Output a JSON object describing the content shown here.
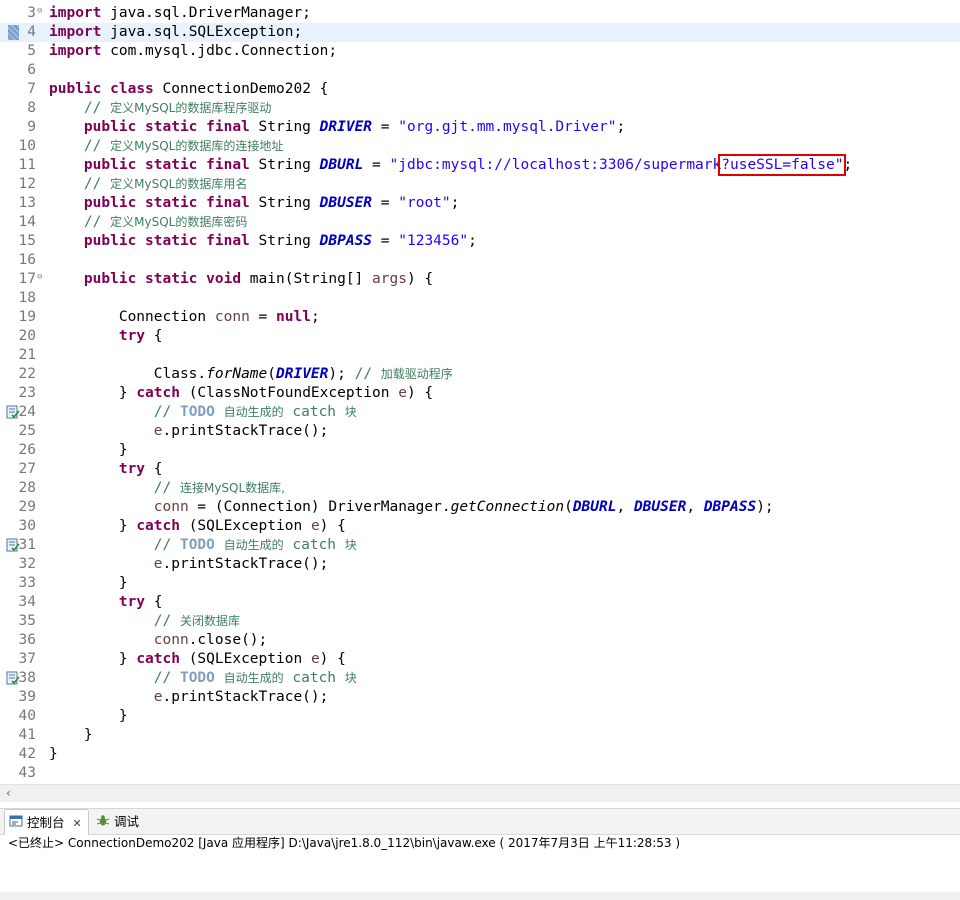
{
  "editor": {
    "lines": [
      {
        "n": "3",
        "fold": "⊖",
        "tokens": [
          [
            "kw",
            "import"
          ],
          [
            "",
            "java.sql.DriverManager;"
          ]
        ]
      },
      {
        "n": "4",
        "tokens": [
          [
            "kw",
            "import"
          ],
          [
            "",
            "java.sql.SQLException;"
          ]
        ]
      },
      {
        "n": "5",
        "tokens": [
          [
            "kw",
            "import"
          ],
          [
            "",
            "com.mysql.jdbc.Connection;"
          ]
        ]
      },
      {
        "n": "6",
        "tokens": []
      },
      {
        "n": "7",
        "tokens": [
          [
            "kw",
            "public"
          ],
          [
            "kw",
            "class"
          ],
          [
            "",
            "ConnectionDemo202 {"
          ]
        ]
      },
      {
        "n": "8",
        "tokens": [
          [
            "cm",
            "// "
          ],
          [
            "cm cjk",
            "定义MySQL的数据库程序驱动"
          ]
        ]
      },
      {
        "n": "9",
        "tokens": [
          [
            "kw",
            "public static final"
          ],
          [
            "",
            "String"
          ],
          [
            "cst",
            "DRIVER"
          ],
          [
            "",
            "="
          ],
          [
            "str",
            "\"org.gjt.mm.mysql.Driver\""
          ],
          [
            "",
            ";"
          ]
        ]
      },
      {
        "n": "10",
        "tokens": [
          [
            "cm",
            "// "
          ],
          [
            "cm cjk",
            "定义MySQL的数据库的连接地址"
          ]
        ]
      },
      {
        "n": "11",
        "tokens": [
          [
            "kw",
            "public static final"
          ],
          [
            "",
            "String"
          ],
          [
            "cst",
            "DBURL"
          ],
          [
            "",
            "="
          ],
          [
            "str",
            "\"jdbc:mysql://localhost:3306/supermark"
          ],
          [
            "str box",
            "?useSSL=false\""
          ],
          [
            "",
            ";"
          ]
        ]
      },
      {
        "n": "12",
        "tokens": [
          [
            "cm",
            "// "
          ],
          [
            "cm cjk",
            "定义MySQL的数据库用名"
          ]
        ]
      },
      {
        "n": "13",
        "tokens": [
          [
            "kw",
            "public static final"
          ],
          [
            "",
            "String"
          ],
          [
            "cst",
            "DBUSER"
          ],
          [
            "",
            "="
          ],
          [
            "str",
            "\"root\""
          ],
          [
            "",
            ";"
          ]
        ]
      },
      {
        "n": "14",
        "tokens": [
          [
            "cm",
            "// "
          ],
          [
            "cm cjk",
            "定义MySQL的数据库密码"
          ]
        ]
      },
      {
        "n": "15",
        "tokens": [
          [
            "kw",
            "public static final"
          ],
          [
            "",
            "String"
          ],
          [
            "cst",
            "DBPASS"
          ],
          [
            "",
            "="
          ],
          [
            "str",
            "\"123456\""
          ],
          [
            "",
            ";"
          ]
        ]
      },
      {
        "n": "16",
        "tokens": []
      },
      {
        "n": "17",
        "fold": "⊖",
        "tokens": [
          [
            "kw",
            "public static void"
          ],
          [
            "",
            "main(String[]"
          ],
          [
            "var",
            "args"
          ],
          [
            "",
            ") {"
          ]
        ]
      },
      {
        "n": "18",
        "tokens": []
      },
      {
        "n": "19",
        "tokens": [
          [
            "",
            "Connection"
          ],
          [
            "var",
            "conn"
          ],
          [
            "",
            "="
          ],
          [
            "kw",
            "null"
          ],
          [
            "",
            ";"
          ]
        ]
      },
      {
        "n": "20",
        "tokens": [
          [
            "kw",
            "try"
          ],
          [
            "",
            "{"
          ]
        ]
      },
      {
        "n": "21",
        "tokens": []
      },
      {
        "n": "22",
        "tokens": [
          [
            "",
            "Class."
          ],
          [
            "it",
            "forName"
          ],
          [
            "",
            "("
          ],
          [
            "cst",
            "DRIVER"
          ],
          [
            "",
            ");"
          ],
          [
            "cm",
            "// "
          ],
          [
            "cm cjk",
            "加载驱动程序"
          ]
        ]
      },
      {
        "n": "23",
        "tokens": [
          [
            "",
            "}"
          ],
          [
            "kw",
            "catch"
          ],
          [
            "",
            "(ClassNotFoundException"
          ],
          [
            "var",
            "e"
          ],
          [
            "",
            ") {"
          ]
        ]
      },
      {
        "n": "24",
        "mark": "task",
        "tokens": [
          [
            "cm",
            "//"
          ],
          [
            "todo",
            "TODO"
          ],
          [
            "cm cjk",
            "自动生成的"
          ],
          [
            "cm",
            "catch"
          ],
          [
            "cm cjk",
            "块"
          ]
        ]
      },
      {
        "n": "25",
        "tokens": [
          [
            "var",
            "e"
          ],
          [
            "",
            ".printStackTrace();"
          ]
        ]
      },
      {
        "n": "26",
        "tokens": [
          [
            "",
            "}"
          ]
        ]
      },
      {
        "n": "27",
        "tokens": [
          [
            "kw",
            "try"
          ],
          [
            "",
            "{"
          ]
        ]
      },
      {
        "n": "28",
        "tokens": [
          [
            "cm",
            "// "
          ],
          [
            "cm cjk",
            "连接MySQL数据库,"
          ]
        ]
      },
      {
        "n": "29",
        "tokens": [
          [
            "var",
            "conn"
          ],
          [
            "",
            "= (Connection) DriverManager."
          ],
          [
            "it",
            "getConnection"
          ],
          [
            "",
            "("
          ],
          [
            "cst",
            "DBURL"
          ],
          [
            "",
            ","
          ],
          [
            "cst",
            "DBUSER"
          ],
          [
            "",
            ","
          ],
          [
            "cst",
            "DBPASS"
          ],
          [
            "",
            ");"
          ]
        ]
      },
      {
        "n": "30",
        "tokens": [
          [
            "",
            "}"
          ],
          [
            "kw",
            "catch"
          ],
          [
            "",
            "(SQLException"
          ],
          [
            "var",
            "e"
          ],
          [
            "",
            ") {"
          ]
        ]
      },
      {
        "n": "31",
        "mark": "task",
        "tokens": [
          [
            "cm",
            "//"
          ],
          [
            "todo",
            "TODO"
          ],
          [
            "cm cjk",
            "自动生成的"
          ],
          [
            "cm",
            "catch"
          ],
          [
            "cm cjk",
            "块"
          ]
        ]
      },
      {
        "n": "32",
        "tokens": [
          [
            "var",
            "e"
          ],
          [
            "",
            ".printStackTrace();"
          ]
        ]
      },
      {
        "n": "33",
        "tokens": [
          [
            "",
            "}"
          ]
        ]
      },
      {
        "n": "34",
        "tokens": [
          [
            "kw",
            "try"
          ],
          [
            "",
            "{"
          ]
        ]
      },
      {
        "n": "35",
        "tokens": [
          [
            "cm",
            "// "
          ],
          [
            "cm cjk",
            "关闭数据库"
          ]
        ]
      },
      {
        "n": "36",
        "tokens": [
          [
            "var",
            "conn"
          ],
          [
            "",
            ".close();"
          ]
        ]
      },
      {
        "n": "37",
        "tokens": [
          [
            "",
            "}"
          ],
          [
            "kw",
            "catch"
          ],
          [
            "",
            "(SQLException"
          ],
          [
            "var",
            "e"
          ],
          [
            "",
            ") {"
          ]
        ]
      },
      {
        "n": "38",
        "mark": "task",
        "tokens": [
          [
            "cm",
            "//"
          ],
          [
            "todo",
            "TODO"
          ],
          [
            "cm cjk",
            "自动生成的"
          ],
          [
            "cm",
            "catch"
          ],
          [
            "cm cjk",
            "块"
          ]
        ]
      },
      {
        "n": "39",
        "tokens": [
          [
            "var",
            "e"
          ],
          [
            "",
            ".printStackTrace();"
          ]
        ]
      },
      {
        "n": "40",
        "tokens": [
          [
            "",
            "}"
          ]
        ]
      },
      {
        "n": "41",
        "tokens": [
          [
            "",
            "}"
          ]
        ]
      },
      {
        "n": "42",
        "tokens": [
          [
            "",
            "}"
          ]
        ]
      },
      {
        "n": "43",
        "tokens": []
      }
    ]
  },
  "console": {
    "tabs": [
      {
        "label": "控制台",
        "active": true,
        "icon": "console-icon"
      },
      {
        "label": "调试",
        "active": false,
        "icon": "debug-icon"
      }
    ],
    "status": "<已终止> ConnectionDemo202 [Java 应用程序] D:\\Java\\jre1.8.0_112\\bin\\javaw.exe ( 2017年7月3日 上午11:28:53 )"
  },
  "colors": {
    "keyword": "#7f0055",
    "string": "#2a00ff",
    "constant": "#0000c0",
    "comment": "#3f7f5f",
    "highlight": "#e8f2fe",
    "annotation_box": "#e00000"
  }
}
